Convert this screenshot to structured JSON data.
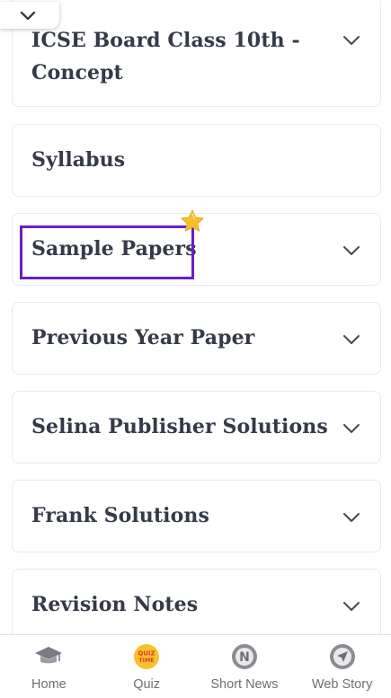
{
  "accordion": {
    "items": [
      {
        "label": "ICSE Board Class 10th - Concept"
      },
      {
        "label": "Syllabus"
      },
      {
        "label": "Sample Papers"
      },
      {
        "label": "Previous Year Paper"
      },
      {
        "label": "Selina Publisher Solutions"
      },
      {
        "label": "Frank Solutions"
      },
      {
        "label": "Revision Notes"
      }
    ]
  },
  "bottom_nav": {
    "items": [
      {
        "label": "Home",
        "icon": "graduation-cap-icon"
      },
      {
        "label": "Quiz",
        "icon": "quiz-time-icon",
        "badge": "QUIZ TIME"
      },
      {
        "label": "Short News",
        "icon": "news-n-icon",
        "badge": "N"
      },
      {
        "label": "Web Story",
        "icon": "compass-arrow-icon"
      }
    ]
  },
  "colors": {
    "highlight": "#6a1fc2",
    "text": "#353a47",
    "nav_text": "#6d6f77",
    "star": "#f5c02a"
  }
}
